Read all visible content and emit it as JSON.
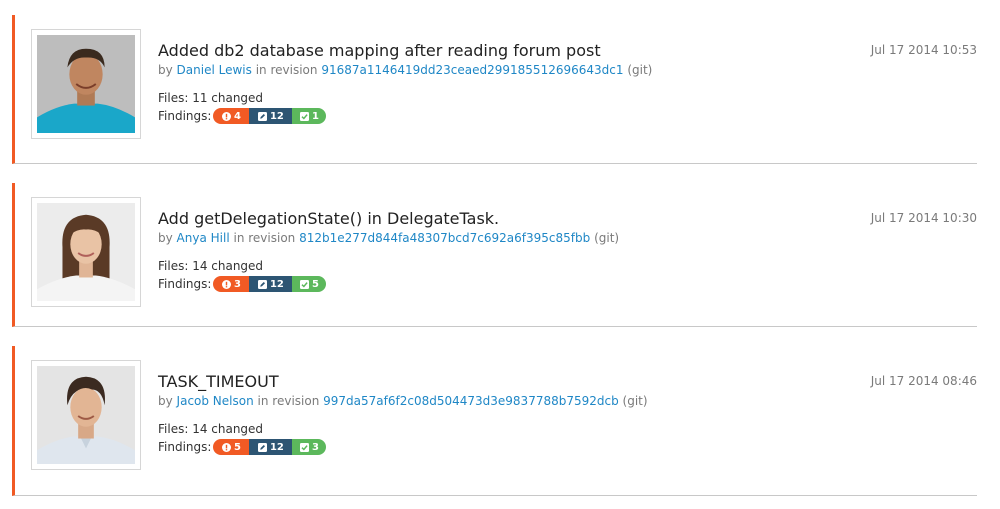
{
  "commits": [
    {
      "title": "Added db2 database mapping after reading forum post",
      "by": "by",
      "author": "Daniel Lewis",
      "in_revision": "in revision",
      "revision": "91687a1146419dd23ceaed299185512696643dc1",
      "vcs": "(git)",
      "date": "Jul 17 2014 10:53",
      "files": "Files: 11 changed",
      "findings_label": "Findings:",
      "findings": {
        "errors": "4",
        "edits": "12",
        "ok": "1"
      }
    },
    {
      "title": "Add getDelegationState() in DelegateTask.",
      "by": "by",
      "author": "Anya Hill",
      "in_revision": "in revision",
      "revision": "812b1e277d844fa48307bcd7c692a6f395c85fbb",
      "vcs": "(git)",
      "date": "Jul 17 2014 10:30",
      "files": "Files: 14 changed",
      "findings_label": "Findings:",
      "findings": {
        "errors": "3",
        "edits": "12",
        "ok": "5"
      }
    },
    {
      "title": "TASK_TIMEOUT",
      "by": "by",
      "author": "Jacob Nelson",
      "in_revision": "in revision",
      "revision": "997da57af6f2c08d504473d3e9837788b7592dcb",
      "vcs": "(git)",
      "date": "Jul 17 2014 08:46",
      "files": "Files: 14 changed",
      "findings_label": "Findings:",
      "findings": {
        "errors": "5",
        "edits": "12",
        "ok": "3"
      }
    }
  ],
  "colors": {
    "accent": "#f15a24",
    "link": "#1f87c6",
    "badge_error": "#f15a24",
    "badge_edit": "#2d5573",
    "badge_ok": "#5cb85c"
  },
  "icons": {
    "error": "exclamation-circle-icon",
    "edit": "pencil-square-icon",
    "ok": "check-square-icon"
  }
}
